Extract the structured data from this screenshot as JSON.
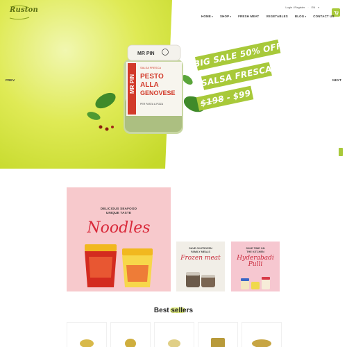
{
  "brand": {
    "logo_text": "Ruston"
  },
  "topbar": {
    "account": "Login / Register",
    "language": "EN"
  },
  "nav": [
    {
      "label": "HOME",
      "has_dropdown": true
    },
    {
      "label": "SHOP",
      "has_dropdown": true
    },
    {
      "label": "FRESH MEAT",
      "has_dropdown": false
    },
    {
      "label": "VEGETABLES",
      "has_dropdown": false
    },
    {
      "label": "BLOG",
      "has_dropdown": true
    },
    {
      "label": "CONTACT US",
      "has_dropdown": false
    }
  ],
  "slider": {
    "prev_label": "PREV",
    "next_label": "NEXT",
    "line1": "BIG SALE 50% OFF",
    "line2": "SALSA FRESCA",
    "old_price": "$198",
    "price_sep": "-",
    "new_price": "$99",
    "jar": {
      "brand": "MR PIN",
      "sub": "SALSA FRESCA",
      "name_1": "PESTO",
      "name_2": "ALLA",
      "name_3": "GENOVESE",
      "foot": "PER PASTA & PIZZA"
    }
  },
  "promos": {
    "big": {
      "top_line_1": "DELICIOUS SEAFOOD",
      "top_line_2": "UNIQUE TASTE",
      "script": "Noodles"
    },
    "small_1": {
      "top_line_1": "SAVE ON FROZEN",
      "top_line_2": "FAMILY MEALS",
      "script": "Frozen meat"
    },
    "small_2": {
      "top_line_1": "SAVE TIME ON",
      "top_line_2": "THE KITCHEN",
      "script_1": "Hyderabadi",
      "script_2": "Pulli"
    }
  },
  "section_title": "Best sellers",
  "colors": {
    "accent": "#a8c93a",
    "hero_green": "#d7e63a",
    "promo_pink": "#f7c9cc",
    "script_red": "#d9293a"
  },
  "icons": {
    "cart": "cart-icon"
  }
}
